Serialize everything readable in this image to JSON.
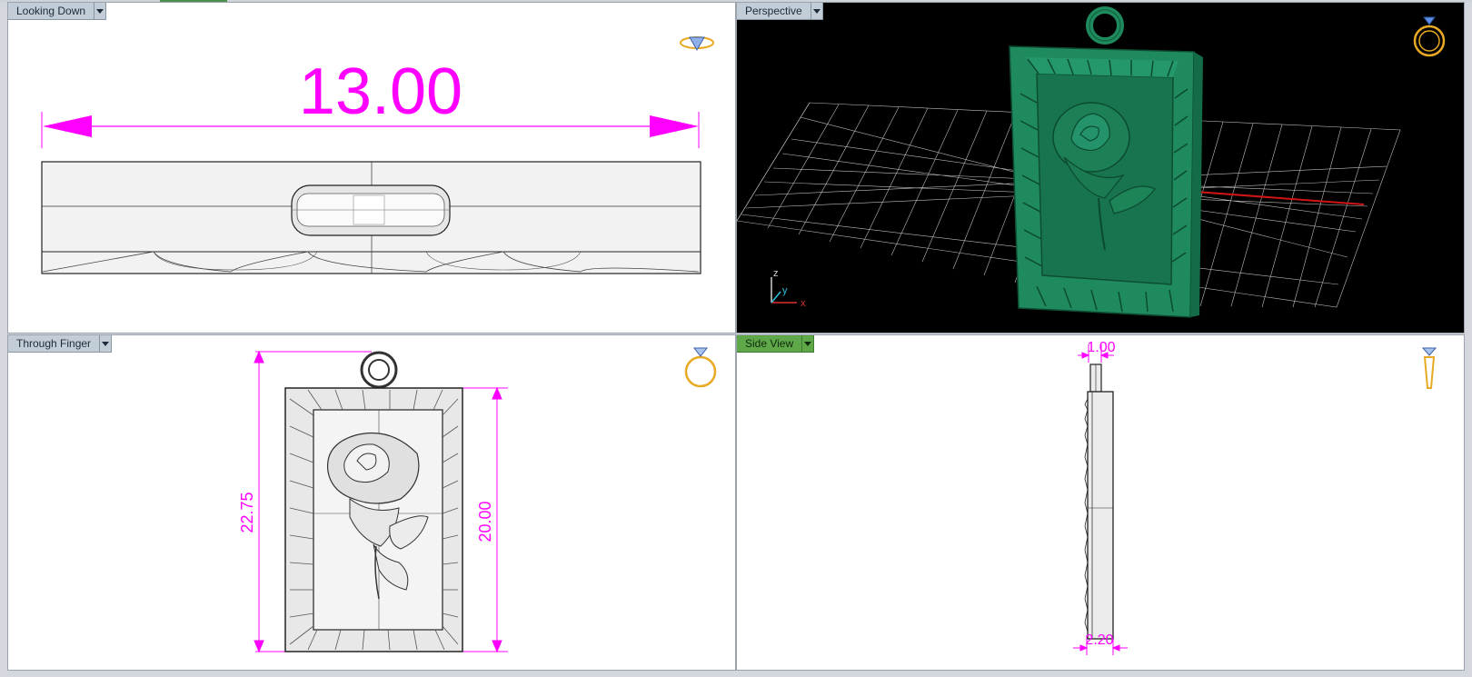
{
  "viewports": {
    "top_left": {
      "label": "Looking Down",
      "icon": "ring-top-icon",
      "dimension": "13.00"
    },
    "top_right": {
      "label": "Perspective",
      "icon": "ring-perspective-icon",
      "axes": {
        "z": "z",
        "y": "y",
        "x": "x"
      }
    },
    "bottom_left": {
      "label": "Through Finger",
      "icon": "ring-front-icon",
      "dimension_height": "22.75",
      "dimension_frame": "20.00"
    },
    "bottom_right": {
      "label": "Side View",
      "icon": "ring-side-icon",
      "active": true,
      "dimension_top": "1.00",
      "dimension_bottom": "2.20"
    }
  },
  "colors": {
    "dimension": "#ff00ff",
    "pendant": "#1f8a5e",
    "grid_dark_bg": "#000000",
    "active_tab": "#5fa84a"
  }
}
